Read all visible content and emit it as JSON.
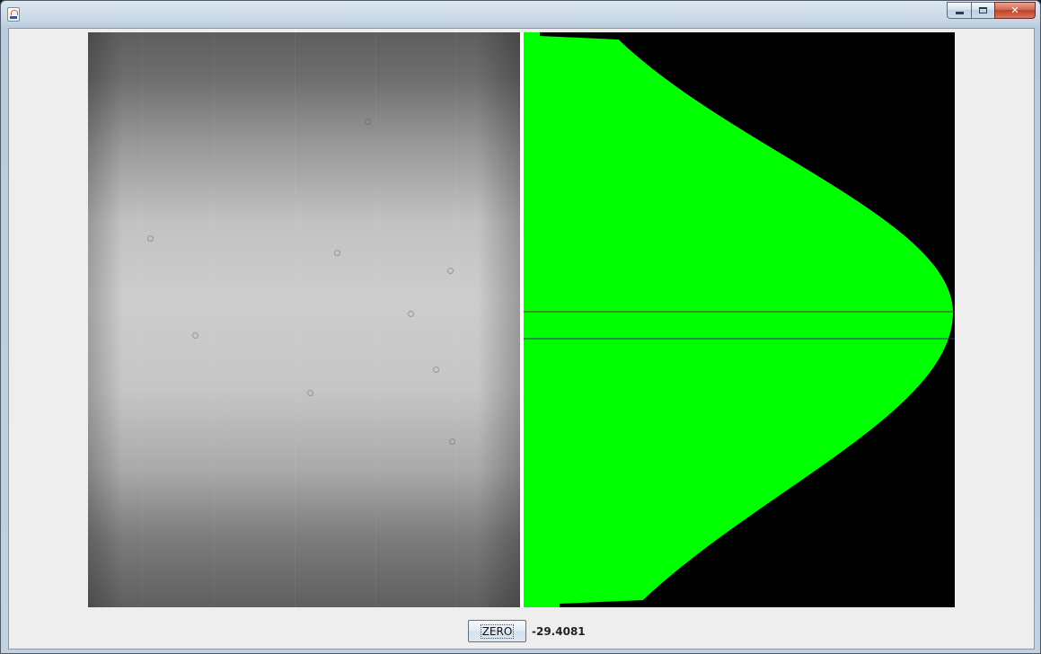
{
  "window": {
    "title": "",
    "controls": {
      "minimize": "minimize-icon",
      "maximize": "maximize-icon",
      "close": "✕"
    }
  },
  "camera_view": {
    "icon": "grayscale-camera-frame"
  },
  "profile_plot": {
    "fill_color": "#00ff00",
    "background_color": "#000000",
    "marker_color": "#7a2a4a",
    "marker_color_2": "#3a2a7a"
  },
  "controls": {
    "zero_label": "ZERO",
    "zero_value": "-29.4081"
  }
}
